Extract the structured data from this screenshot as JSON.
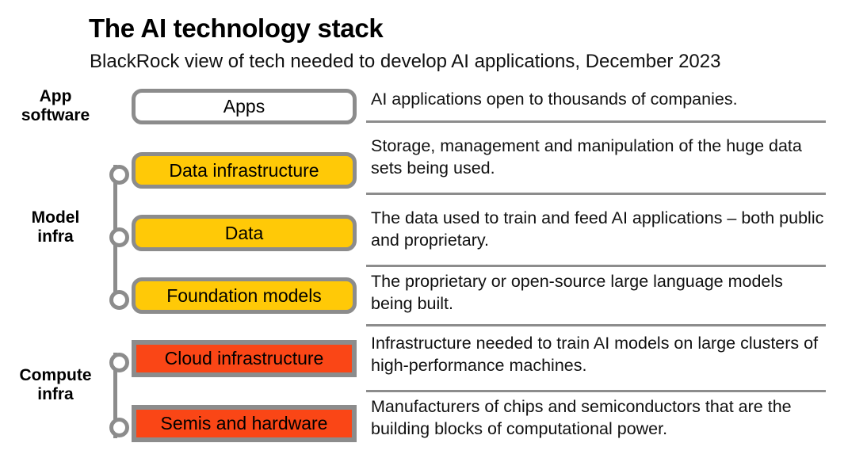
{
  "header": {
    "title": "The AI technology stack",
    "subtitle": "BlackRock view of tech needed to develop AI applications, December 2023"
  },
  "colors": {
    "yellow": "#FFC907",
    "red": "#FA4616",
    "white": "#FFFFFF",
    "border_gray": "#8C8C8C",
    "divider_gray": "#8C8C8C",
    "text": "#111111"
  },
  "groups": [
    {
      "label": "App\nsoftware",
      "name": "app-software"
    },
    {
      "label": "Model\ninfra",
      "name": "model-infra"
    },
    {
      "label": "Compute\ninfra",
      "name": "compute-infra"
    }
  ],
  "layers": [
    {
      "name": "apps",
      "box_label": "Apps",
      "fill": "#FFFFFF",
      "shape": "rounded",
      "description": "AI applications open to thousands of companies."
    },
    {
      "name": "data-infrastructure",
      "box_label": "Data infrastructure",
      "fill": "#FFC907",
      "shape": "rounded",
      "description": "Storage, management and manipulation of the huge data sets being used."
    },
    {
      "name": "data",
      "box_label": "Data",
      "fill": "#FFC907",
      "shape": "rounded",
      "description": "The data used to train and feed AI applications – both public and proprietary."
    },
    {
      "name": "foundation-models",
      "box_label": "Foundation models",
      "fill": "#FFC907",
      "shape": "rounded",
      "description": "The proprietary or open-source large language models being built."
    },
    {
      "name": "cloud-infrastructure",
      "box_label": "Cloud infrastructure",
      "fill": "#FA4616",
      "shape": "square",
      "description": "Infrastructure needed to train AI models on large clusters of high-performance machines."
    },
    {
      "name": "semis-and-hardware",
      "box_label": "Semis and hardware",
      "fill": "#FA4616",
      "shape": "square",
      "description": "Manufacturers of chips and semiconductors that are the building blocks of computational power."
    }
  ]
}
